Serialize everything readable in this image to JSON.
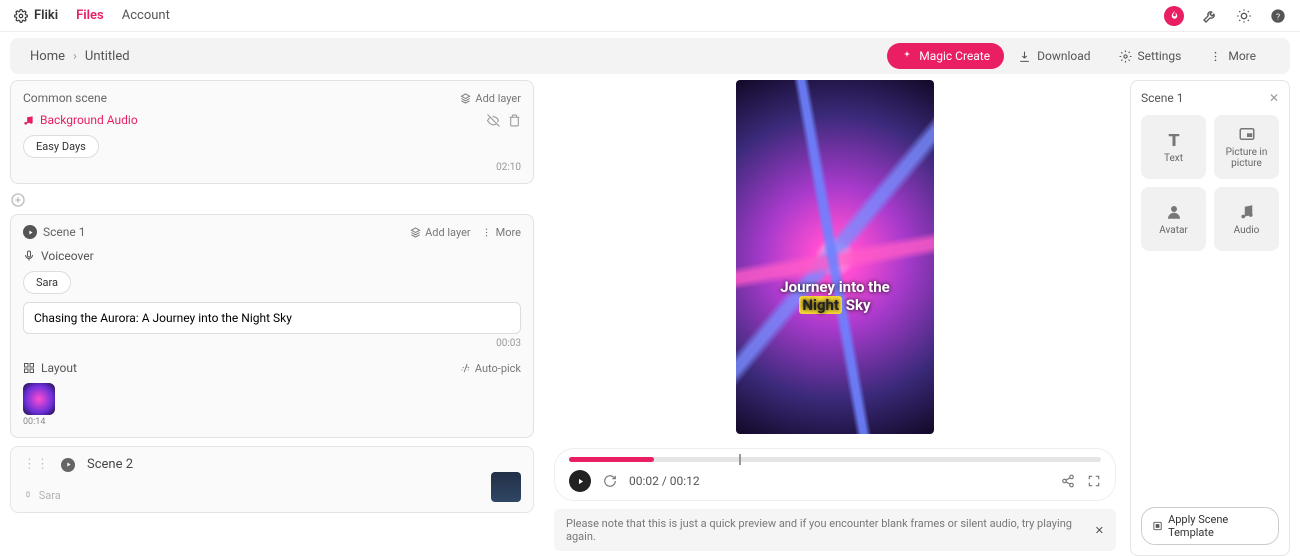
{
  "nav": {
    "brand": "Fliki",
    "files": "Files",
    "account": "Account"
  },
  "breadcrumb": {
    "home": "Home",
    "title": "Untitled"
  },
  "actions": {
    "magic": "Magic Create",
    "download": "Download",
    "settings": "Settings",
    "more": "More"
  },
  "common": {
    "title": "Common scene",
    "add_layer": "Add layer",
    "bg_audio": "Background Audio",
    "track": "Easy Days",
    "duration": "02:10"
  },
  "scene1": {
    "title": "Scene 1",
    "add_layer": "Add layer",
    "more": "More",
    "voiceover": "Voiceover",
    "voice": "Sara",
    "script": "Chasing the Aurora: A Journey into the Night Sky",
    "script_dur": "00:03",
    "layout": "Layout",
    "autopick": "Auto-pick",
    "clip_dur": "00:14"
  },
  "scene2": {
    "title": "Scene 2",
    "voice": "Sara"
  },
  "preview": {
    "line1": "Journey into the",
    "hl": "Night",
    "line2_rest": " Sky"
  },
  "player": {
    "time": "00:02 / 00:12"
  },
  "note": "Please note that this is just a quick preview and if you encounter blank frames or silent audio, try playing again.",
  "right": {
    "title": "Scene 1",
    "text": "Text",
    "pip": "Picture in picture",
    "avatar": "Avatar",
    "audio": "Audio",
    "apply": "Apply Scene Template"
  }
}
